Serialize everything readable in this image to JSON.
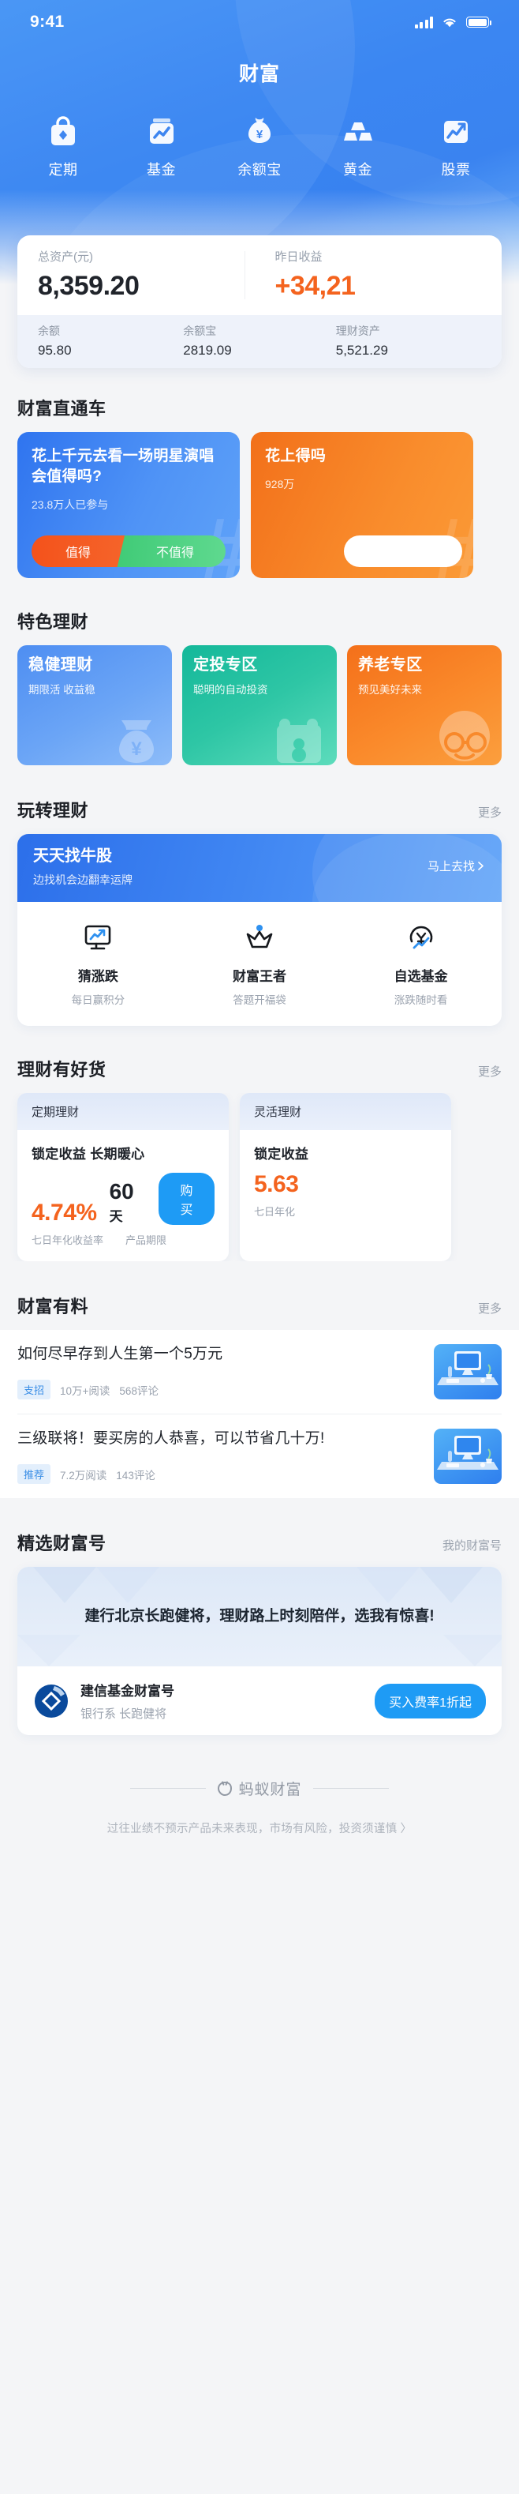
{
  "statusbar": {
    "time": "9:41",
    "signal_icon": "signal-bars-icon",
    "wifi_icon": "wifi-icon",
    "battery_icon": "battery-icon"
  },
  "header": {
    "title": "财富"
  },
  "quicknav": {
    "items": [
      {
        "label": "定期",
        "icon": "lock-bag-icon"
      },
      {
        "label": "基金",
        "icon": "fund-chart-icon"
      },
      {
        "label": "余额宝",
        "icon": "money-bag-yuan-icon"
      },
      {
        "label": "黄金",
        "icon": "gold-bars-icon"
      },
      {
        "label": "股票",
        "icon": "stock-trend-icon"
      }
    ]
  },
  "assets": {
    "total_label": "总资产(元)",
    "total_value": "8,359.20",
    "profit_label": "昨日收益",
    "profit_value": "+34,21",
    "breakdown": [
      {
        "label": "余额",
        "value": "95.80"
      },
      {
        "label": "余额宝",
        "value": "2819.09"
      },
      {
        "label": "理财资产",
        "value": "5,521.29"
      }
    ]
  },
  "express": {
    "title": "财富直通车",
    "cards": [
      {
        "question": "花上千元去看一场明星演唱会值得吗?",
        "participants": "23.8万人已参与",
        "yes_label": "值得",
        "no_label": "不值得",
        "hash": "#"
      },
      {
        "question": "花上得吗",
        "participants": "928万",
        "yes_label": "",
        "no_label": "",
        "hash": "#"
      }
    ]
  },
  "featured": {
    "title": "特色理财",
    "cards": [
      {
        "title": "稳健理财",
        "subtitle": "期限活 收益稳",
        "art": "ingot-bag-icon"
      },
      {
        "title": "定投专区",
        "subtitle": "聪明的自动投资",
        "art": "calendar-icon"
      },
      {
        "title": "养老专区",
        "subtitle": "预见美好未来",
        "art": "elder-face-icon"
      }
    ]
  },
  "play": {
    "title": "玩转理财",
    "more": "更多",
    "banner": {
      "title": "天天找牛股",
      "subtitle": "边找机会边翻幸运牌",
      "cta": "马上去找",
      "cta_icon": "chevron-right-icon"
    },
    "grid": [
      {
        "title": "猜涨跌",
        "subtitle": "每日赢积分",
        "icon": "monitor-trend-icon"
      },
      {
        "title": "财富王者",
        "subtitle": "答题开福袋",
        "icon": "crown-icon"
      },
      {
        "title": "自选基金",
        "subtitle": "涨跌随时看",
        "icon": "yuan-trend-icon"
      }
    ]
  },
  "goods": {
    "title": "理财有好货",
    "more": "更多",
    "cards": [
      {
        "tab": "定期理财",
        "slogan": "锁定收益 长期暖心",
        "rate": "4.74%",
        "rate_label": "七日年化收益率",
        "term": "60",
        "term_unit": "天",
        "term_label": "产品期限",
        "buy_label": "购买"
      },
      {
        "tab": "灵活理财",
        "slogan": "锁定收益",
        "rate": "5.63",
        "rate_label": "七日年化",
        "term": "",
        "term_unit": "",
        "term_label": "",
        "buy_label": ""
      }
    ]
  },
  "news": {
    "title": "财富有料",
    "more": "更多",
    "items": [
      {
        "title": "如何尽早存到人生第一个5万元",
        "tag": "支招",
        "reads": "10万+阅读",
        "comments": "568评论",
        "thumb": "desk-computer-thumb"
      },
      {
        "title": "三级联将！要买房的人恭喜，可以节省几十万!",
        "tag": "推荐",
        "reads": "7.2万阅读",
        "comments": "143评论",
        "thumb": "desk-computer-thumb"
      }
    ]
  },
  "accounts": {
    "title": "精选财富号",
    "more": "我的财富号",
    "card": {
      "slogan": "建行北京长跑健将，理财路上时刻陪伴，选我有惊喜!",
      "logo": "ccb-logo-icon",
      "name": "建信基金财富号",
      "tags": "银行系  长跑健将",
      "button": "买入费率1折起"
    }
  },
  "footer": {
    "brand": "蚂蚁财富",
    "brand_icon": "ant-fortune-logo-icon",
    "disclaimer": "过往业绩不预示产品未来表现，市场有风险，投资须谨慎 〉"
  }
}
